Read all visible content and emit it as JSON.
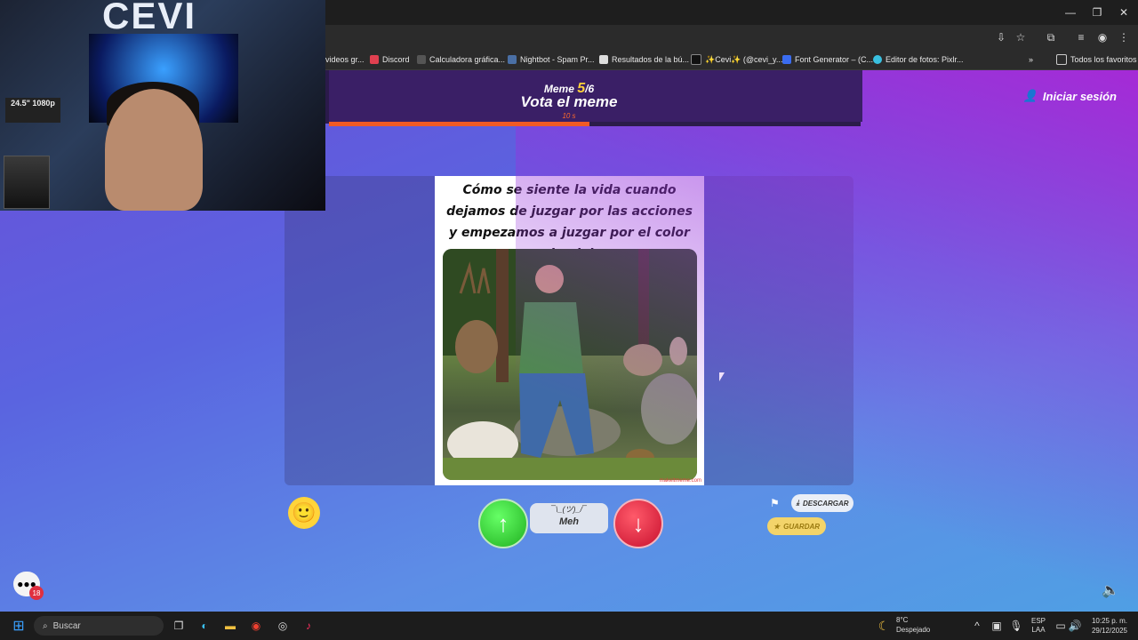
{
  "browser": {
    "bookmarks": [
      {
        "label": "videos gr...",
        "icon": "folder-icon"
      },
      {
        "label": "Discord",
        "icon": "discord-icon"
      },
      {
        "label": "Calculadora gráfica...",
        "icon": "calculator-icon"
      },
      {
        "label": "Nightbot - Spam Pr...",
        "icon": "nightbot-icon"
      },
      {
        "label": "Resultados de la bú...",
        "icon": "search-result-icon"
      },
      {
        "label": "✨Cevi✨ (@cevi_y...",
        "icon": "tiktok-icon"
      },
      {
        "label": "Font Generator – (C...",
        "icon": "font-icon"
      },
      {
        "label": "Editor de fotos: Pixlr...",
        "icon": "pixlr-icon"
      }
    ],
    "all_bookmarks": "Todos los favoritos"
  },
  "header": {
    "meme_label": "Meme",
    "meme_current": "5",
    "meme_total": "/6",
    "title": "Vota el meme",
    "timer": "10 s",
    "progress_fraction": 0.49,
    "login": "Iniciar sesión"
  },
  "meme": {
    "caption": "Cómo se siente la vida cuando dejamos de juzgar por las acciones y empezamos a juzgar por el color de piel",
    "watermark": "makeitmeme.com"
  },
  "actions": {
    "meh_face": "¯\\_(ツ)_/¯",
    "meh_label": "Meh",
    "download": "DESCARGAR",
    "save": "GUARDAR"
  },
  "chat": {
    "badge": "18"
  },
  "webcam": {
    "logo": "CEVI",
    "monitor_text": "24.5\" 1080p"
  },
  "taskbar": {
    "search": "Buscar",
    "weather_temp": "8°C",
    "weather_desc": "Despejado",
    "lang1": "ESP",
    "lang2": "LAA",
    "time": "10:25 p. m.",
    "date": "29/12/2025"
  },
  "colors": {
    "accent": "#f15a24",
    "up": "#2dc22d",
    "down": "#d9163a",
    "save": "#f3d46a"
  }
}
